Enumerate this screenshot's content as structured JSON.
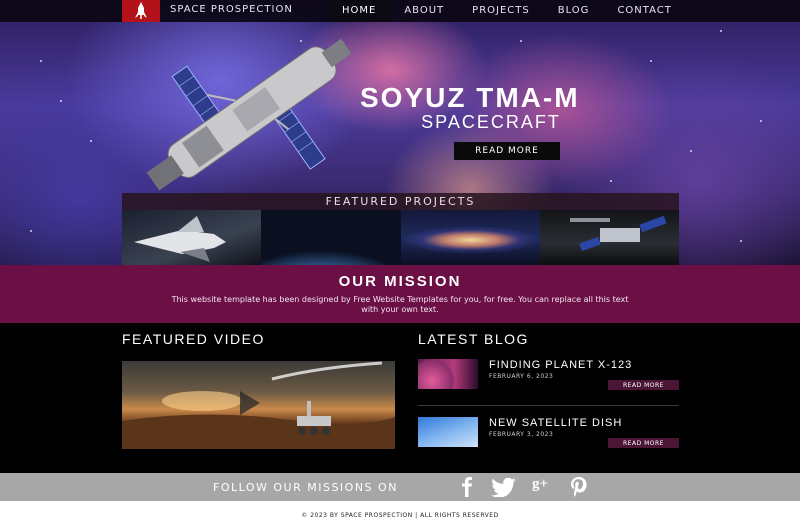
{
  "brand": {
    "name": "Space Prospection"
  },
  "nav": {
    "items": [
      "Home",
      "About",
      "Projects",
      "Blog",
      "Contact"
    ],
    "active": "Home"
  },
  "hero": {
    "title": "Soyuz TMA-M",
    "subtitle": "Spacecraft",
    "button": "Read More"
  },
  "featured_projects": {
    "title": "Featured Projects"
  },
  "mission": {
    "title": "Our Mission",
    "text": "This website template has been designed by Free Website Templates for you, for free. You can replace all this text with your own text."
  },
  "video": {
    "title": "Featured Video"
  },
  "blog": {
    "title": "Latest Blog",
    "posts": [
      {
        "title": "Finding Planet X-123",
        "date": "February 6, 2023",
        "button": "Read More"
      },
      {
        "title": "New Satellite Dish",
        "date": "February 3, 2023",
        "button": "Read More"
      }
    ]
  },
  "follow": {
    "label": "Follow Our Missions On",
    "icons": [
      "facebook-icon",
      "twitter-icon",
      "google-plus-icon",
      "pinterest-icon"
    ]
  },
  "footer": {
    "text": "© 2023 by Space Prospection | All Rights Reserved"
  },
  "colors": {
    "accent_red": "#b3121b",
    "mission_bg": "#6b0f45",
    "button_bg": "#4b1536",
    "follow_bg": "#a7a7a7"
  }
}
